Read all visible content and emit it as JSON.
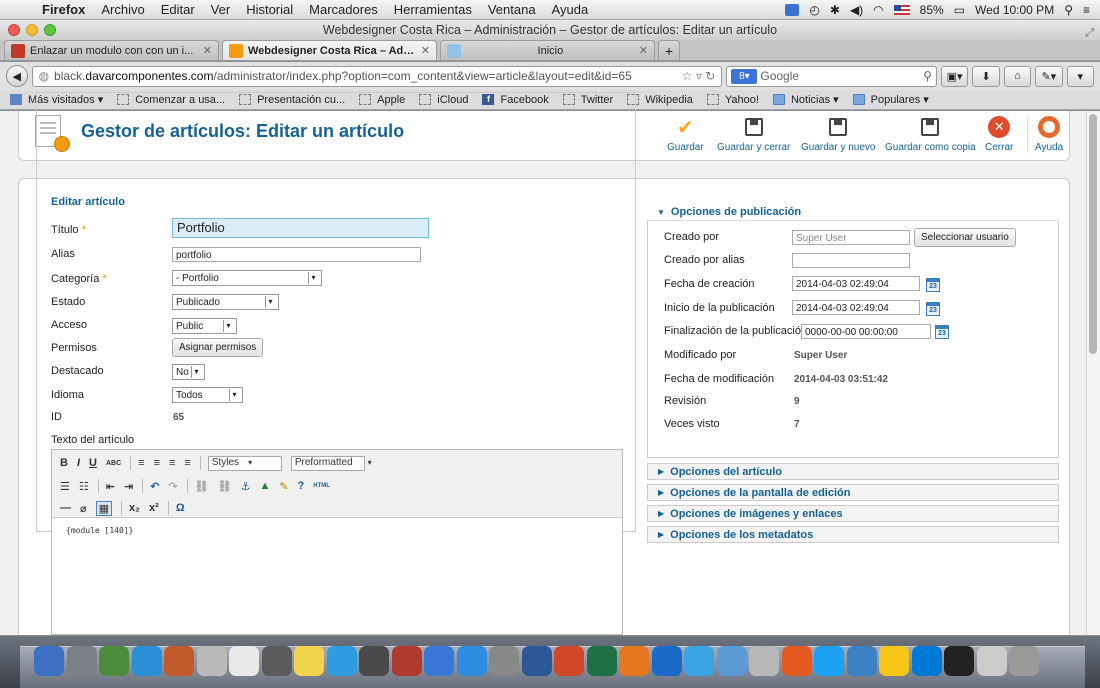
{
  "menubar": {
    "app": "Firefox",
    "items": [
      "Archivo",
      "Editar",
      "Ver",
      "Historial",
      "Marcadores",
      "Herramientas",
      "Ventana",
      "Ayuda"
    ],
    "battery": "85%",
    "clock": "Wed 10:00 PM"
  },
  "window": {
    "title": "Webdesigner Costa Rica – Administración – Gestor de artículos: Editar un artículo"
  },
  "tabs": [
    {
      "label": "Enlazar un modulo con con un i...",
      "favicon_color": "#c0392b"
    },
    {
      "label": "Webdesigner Costa Rica – Admi...",
      "favicon_color": "#f39c12"
    },
    {
      "label": "Inicio",
      "favicon_color": "#8fc4e8"
    }
  ],
  "nav": {
    "url_prefix": "black.",
    "url_domain": "davarcomponentes.com",
    "url_path": "/administrator/index.php?option=com_content&view=article&layout=edit&id=65",
    "search_placeholder": "Google"
  },
  "bookmarks": [
    "Más visitados ▾",
    "Comenzar a usa...",
    "Presentación cu...",
    "Apple",
    "iCloud",
    "Facebook",
    "Twitter",
    "Wikipedia",
    "Yahoo!",
    "Noticias ▾",
    "Populares ▾"
  ],
  "toolbar": {
    "page_title": "Gestor de artículos: Editar un artículo",
    "guardar": "Guardar",
    "guardar_cerrar": "Guardar y cerrar",
    "guardar_nuevo": "Guardar y nuevo",
    "guardar_copia": "Guardar como copia",
    "cerrar": "Cerrar",
    "ayuda": "Ayuda"
  },
  "form": {
    "legend": "Editar artículo",
    "titulo_label": "Título",
    "titulo_value": "Portfolio",
    "alias_label": "Alias",
    "alias_value": "portfolio",
    "categoria_label": "Categoría",
    "categoria_value": "- Portfolio",
    "estado_label": "Estado",
    "estado_value": "Publicado",
    "acceso_label": "Acceso",
    "acceso_value": "Public",
    "permisos_label": "Permisos",
    "permisos_button": "Asignar permisos",
    "destacado_label": "Destacado",
    "destacado_value": "No",
    "idioma_label": "Idioma",
    "idioma_value": "Todos",
    "id_label": "ID",
    "id_value": "65",
    "texto_label": "Texto del artículo",
    "required_mark": "*"
  },
  "editor": {
    "styles": "Styles",
    "format": "Preformatted",
    "content": "{module [140]}"
  },
  "publication": {
    "header": "Opciones de publicación",
    "creado_por_label": "Creado por",
    "creado_por_value": "Super User",
    "seleccionar_usuario": "Seleccionar usuario",
    "creado_alias_label": "Creado por alias",
    "fecha_creacion_label": "Fecha de creación",
    "fecha_creacion_value": "2014-04-03 02:49:04",
    "inicio_label": "Inicio de la publicación",
    "inicio_value": "2014-04-03 02:49:04",
    "fin_label": "Finalización de la publicación",
    "fin_value": "0000-00-00 00:00:00",
    "modificado_label": "Modificado por",
    "modificado_value": "Super User",
    "fecha_mod_label": "Fecha de modificación",
    "fecha_mod_value": "2014-04-03 03:51:42",
    "revision_label": "Revisión",
    "revision_value": "9",
    "visto_label": "Veces visto",
    "visto_value": "7",
    "cal_num": "23"
  },
  "collapsed_panels": [
    "Opciones del artículo",
    "Opciones de la pantalla de edición",
    "Opciones de imágenes y enlaces",
    "Opciones de los metadatos"
  ],
  "dock_colors": [
    "#3d6fc4",
    "#7a7f88",
    "#4c8b3b",
    "#2a8fd6",
    "#c25b2b",
    "#b9b9b9",
    "#e9e9e9",
    "#5b5b5b",
    "#f2d34c",
    "#2d9de0",
    "#4a4a4a",
    "#b03a2e",
    "#3a76d6",
    "#2e8de0",
    "#888",
    "#2b5797",
    "#d24726",
    "#1e7145",
    "#e87722",
    "#1b6ac9",
    "#3aa3e3",
    "#5b9bd5",
    "#b7b7b7",
    "#e4591d",
    "#1da1f2",
    "#3b82c4",
    "#f5c518",
    "#0078d7",
    "#222",
    "#ccc",
    "#999"
  ]
}
